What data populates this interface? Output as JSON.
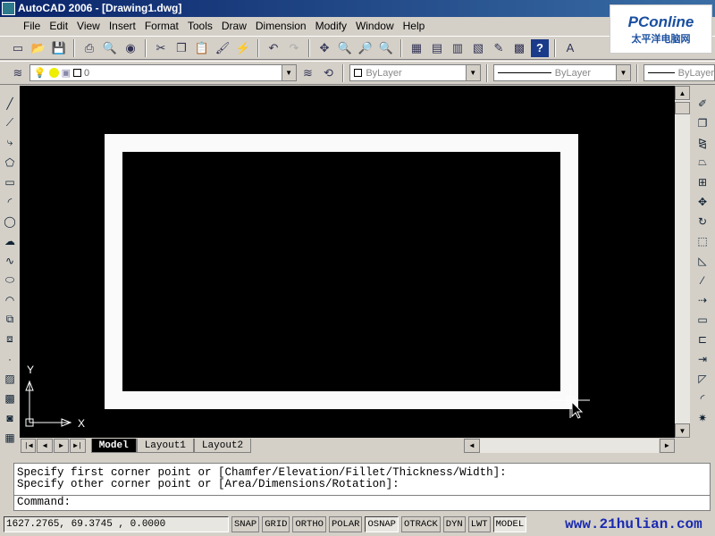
{
  "window": {
    "title": "AutoCAD 2006 - [Drawing1.dwg]"
  },
  "menu": [
    "File",
    "Edit",
    "View",
    "Insert",
    "Format",
    "Tools",
    "Draw",
    "Dimension",
    "Modify",
    "Window",
    "Help"
  ],
  "layer_toolbar": {
    "layer_value": "0",
    "color": "ByLayer",
    "linetype": "ByLayer",
    "lineweight": "ByLayer"
  },
  "tabs": [
    "Model",
    "Layout1",
    "Layout2"
  ],
  "ucs": {
    "x": "X",
    "y": "Y"
  },
  "command": {
    "history": [
      "Specify first corner point or [Chamfer/Elevation/Fillet/Thickness/Width]:",
      "Specify other corner point or [Area/Dimensions/Rotation]:"
    ],
    "prompt": "Command:"
  },
  "status": {
    "coords": "1627.2765, 69.3745  , 0.0000",
    "toggles": [
      {
        "label": "SNAP",
        "on": false
      },
      {
        "label": "GRID",
        "on": false
      },
      {
        "label": "ORTHO",
        "on": false
      },
      {
        "label": "POLAR",
        "on": false
      },
      {
        "label": "OSNAP",
        "on": true
      },
      {
        "label": "OTRACK",
        "on": false
      },
      {
        "label": "DYN",
        "on": false
      },
      {
        "label": "LWT",
        "on": false
      },
      {
        "label": "MODEL",
        "on": true
      }
    ]
  },
  "watermarks": {
    "pconline": "PConline",
    "pconline_cn": "太平洋电脑网",
    "site": "www.21hulian.com"
  },
  "colors": {
    "canvas": "#000000",
    "titlebar": "#0a246a",
    "rectangle": "#fafafa"
  }
}
